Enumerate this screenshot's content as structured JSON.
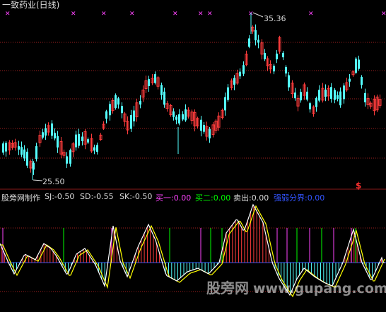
{
  "title": "一致药业(日线)",
  "price_high_label": "35.36",
  "price_low_label": "25.50",
  "signal_marker": "$",
  "indicator": {
    "name": "股旁网制作",
    "items": [
      {
        "text": "SJ:-0.50",
        "color": "#dcdcdc"
      },
      {
        "text": "SD:-0.55",
        "color": "#dcdcdc"
      },
      {
        "text": "SK:-0.50",
        "color": "#dcdcdc"
      },
      {
        "text": "买一:0.00",
        "color": "#ff44ff"
      },
      {
        "text": "买二:0.00",
        "color": "#00ff00"
      },
      {
        "text": "卖出:0.00",
        "color": "#dcdcdc"
      },
      {
        "text": "强弱分界:0.00",
        "color": "#3355ff"
      }
    ]
  },
  "watermark": {
    "text": "股旁网",
    "url": "www.gupang.com"
  },
  "colors": {
    "up": "#ff3c3c",
    "down": "#54ffff",
    "grid": "#a02020",
    "top_marks": "#ff44ff",
    "line_sj": "#ffffff",
    "line_sd": "#ffff00",
    "divider": "#3355ff"
  }
}
